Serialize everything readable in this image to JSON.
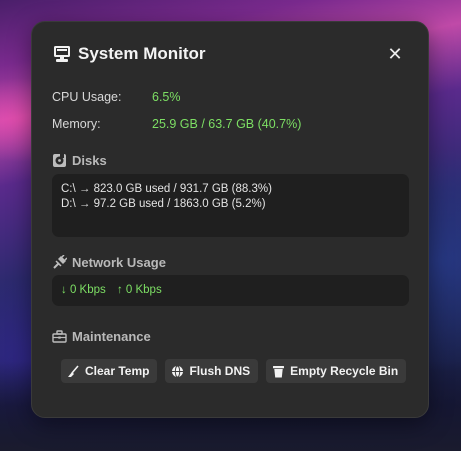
{
  "window": {
    "title": "System Monitor",
    "close_glyph": "✕"
  },
  "stats": {
    "cpu_label": "CPU Usage:",
    "cpu_value": "6.5%",
    "memory_label": "Memory:",
    "memory_value": "25.9 GB / 63.7 GB (40.7%)"
  },
  "disks": {
    "heading": "Disks",
    "lines": [
      "C:\\ → 823.0 GB used / 931.7 GB (88.3%)",
      "D:\\ → 97.2 GB used / 1863.0 GB (5.2%)"
    ]
  },
  "network": {
    "heading": "Network Usage",
    "download": "↓ 0 Kbps",
    "upload": "↑ 0 Kbps"
  },
  "maintenance": {
    "heading": "Maintenance",
    "buttons": [
      {
        "label": "Clear Temp",
        "icon": "broom-icon"
      },
      {
        "label": "Flush DNS",
        "icon": "globe-icon"
      },
      {
        "label": "Empty Recycle Bin",
        "icon": "trash-icon"
      }
    ]
  },
  "colors": {
    "panel_bg": "#2b2b2b",
    "box_bg": "#1f1f1f",
    "accent_green": "#7ddf64",
    "button_bg": "#3a3a3a"
  }
}
